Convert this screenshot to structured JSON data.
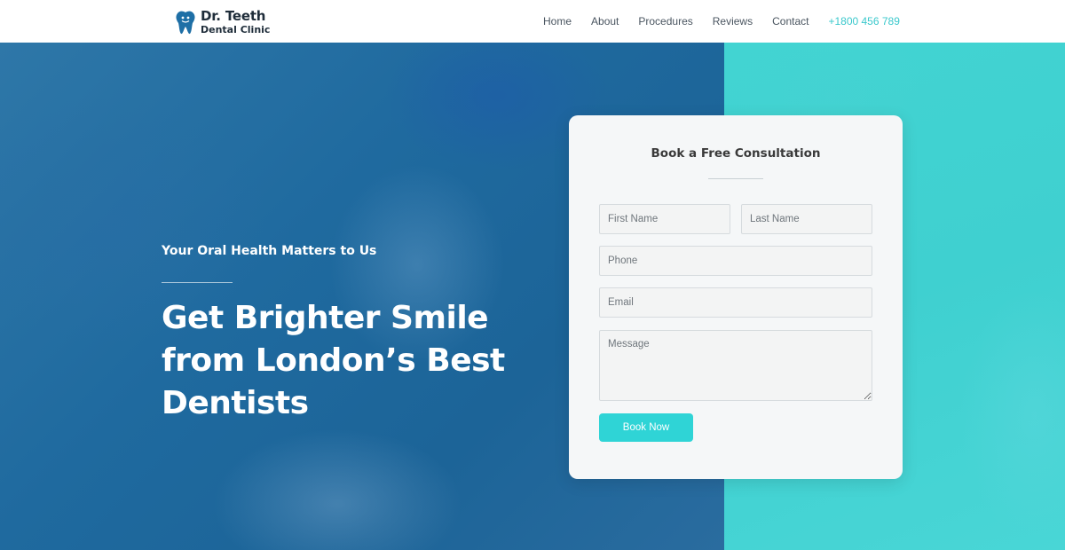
{
  "brand": {
    "name_line1": "Dr. Teeth",
    "name_line2": "Dental Clinic",
    "logo_icon": "tooth-icon",
    "primary_color": "#1e6fa6",
    "accent_color": "#3ac8cc"
  },
  "nav": {
    "items": [
      {
        "label": "Home"
      },
      {
        "label": "About"
      },
      {
        "label": "Procedures"
      },
      {
        "label": "Reviews"
      },
      {
        "label": "Contact"
      }
    ],
    "phone": "+1800 456 789"
  },
  "hero": {
    "kicker": "Your Oral Health Matters to Us",
    "headline": "Get Brighter Smile from London’s Best Dentists"
  },
  "form": {
    "title": "Book a Free Consultation",
    "first_name_placeholder": "First Name",
    "last_name_placeholder": "Last Name",
    "phone_placeholder": "Phone",
    "email_placeholder": "Email",
    "message_placeholder": "Message",
    "submit_label": "Book Now",
    "button_color": "#2fd4d6"
  }
}
